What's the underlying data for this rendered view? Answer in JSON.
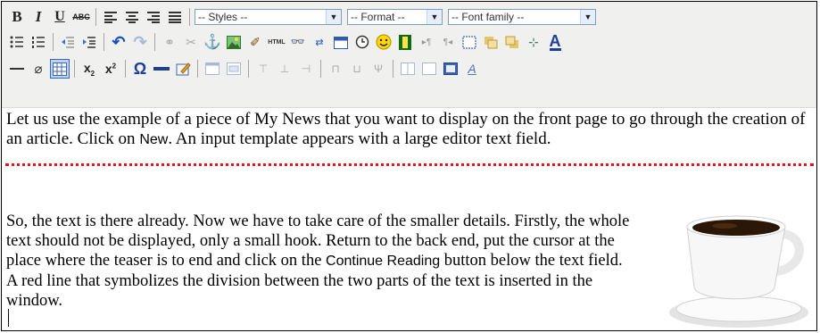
{
  "toolbar": {
    "row1": {
      "bold": "B",
      "italic": "I",
      "underline": "U",
      "strike": "ABC",
      "styles": "-- Styles --",
      "format": "-- Format --",
      "font_family": "-- Font family --"
    },
    "row3": {
      "omega": "Ω",
      "sub": "x",
      "sup": "x"
    }
  },
  "content": {
    "p1_a": "Let us use the example of a piece of My News that you want to display on the front page to go through the creation of an article. Click on ",
    "p1_new": "New",
    "p1_b": ". An input template appears with a large editor text field.",
    "p2_a": "So, the text is there already. Now we have to take care of the smaller details. Firstly, the whole text should not be displayed, only a small hook. Return to the back end, put the cursor at the place where the teaser is to end and click on the ",
    "p2_btn": "Continue Reading",
    "p2_b": " button below the text field. A red line that symbolizes the division between the two parts of the text is inserted in the window."
  }
}
